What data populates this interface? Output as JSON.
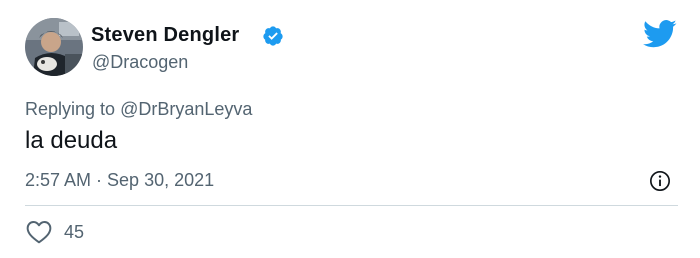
{
  "tweet": {
    "display_name": "Steven Dengler",
    "handle": "@Dracogen",
    "reply_prefix": "Replying to",
    "reply_to": "@DrBryanLeyva",
    "text": "la deuda",
    "timestamp": "2:57 AM · Sep 30, 2021",
    "like_count": "45"
  },
  "icons": {
    "verified": "verified-badge-icon",
    "brand": "twitter-bird-icon",
    "info": "info-icon",
    "like": "heart-icon"
  },
  "colors": {
    "brand_blue": "#1d9bf0",
    "text_primary": "#0f1419",
    "text_secondary": "#536471",
    "divider": "#cfd9de"
  }
}
